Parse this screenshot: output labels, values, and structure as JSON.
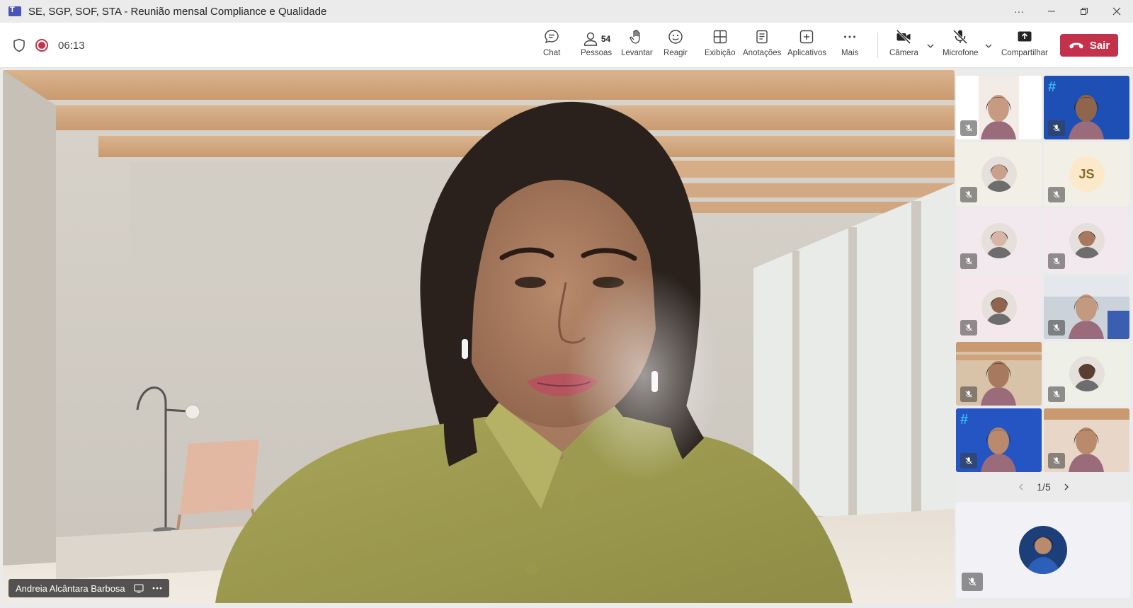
{
  "window": {
    "title": "SE, SGP, SOF, STA - Reunião mensal Compliance e Qualidade"
  },
  "meeting": {
    "timer": "06:13"
  },
  "toolbar": {
    "chat_label": "Chat",
    "people_label": "Pessoas",
    "people_count": "54",
    "raise_label": "Levantar",
    "react_label": "Reagir",
    "view_label": "Exibição",
    "notes_label": "Anotações",
    "apps_label": "Aplicativos",
    "more_label": "Mais",
    "camera_label": "Câmera",
    "mic_label": "Microfone",
    "share_label": "Compartilhar",
    "leave_label": "Sair"
  },
  "stage": {
    "speaker_name": "Andreia Alcântara Barbosa"
  },
  "gallery": {
    "tiles": [
      {
        "kind": "video"
      },
      {
        "kind": "video"
      },
      {
        "kind": "avatar"
      },
      {
        "kind": "initials",
        "initials": "JS"
      },
      {
        "kind": "avatar"
      },
      {
        "kind": "avatar"
      },
      {
        "kind": "avatar"
      },
      {
        "kind": "video"
      },
      {
        "kind": "video"
      },
      {
        "kind": "avatar"
      },
      {
        "kind": "video"
      },
      {
        "kind": "video"
      }
    ],
    "pager": "1/5"
  },
  "colors": {
    "leave": "#c4314b",
    "recording": "#c4314b",
    "teams_brand": "#4b53bc"
  }
}
